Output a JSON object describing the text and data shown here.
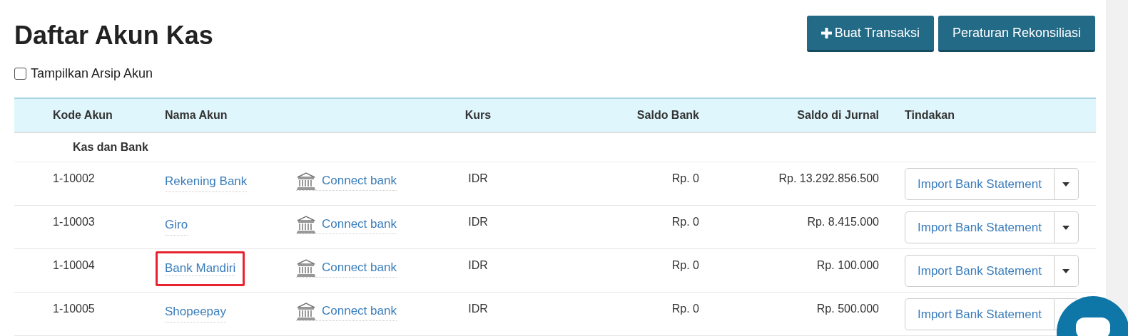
{
  "page": {
    "title": "Daftar Akun Kas"
  },
  "actions": [
    {
      "kind": "create",
      "label": "Buat Transaksi"
    },
    {
      "kind": "rules",
      "label": "Peraturan Rekonsiliasi"
    }
  ],
  "show_archive": {
    "label": "Tampilkan Arsip Akun",
    "checked": false
  },
  "table": {
    "columns": [
      {
        "label": "Kode Akun"
      },
      {
        "label": "Nama Akun"
      },
      {},
      {
        "label": "Kurs"
      },
      {
        "label": "Saldo Bank"
      },
      {
        "label": "Saldo di Jurnal"
      },
      {
        "label": "Tindakan"
      }
    ],
    "group": "Kas dan Bank",
    "rows": [
      {
        "code": "1-10002",
        "name": "Rekening Bank",
        "highlighted": false,
        "connect": "Connect bank",
        "currency": "IDR",
        "bank_balance": "Rp. 0",
        "journal_balance": "Rp. 13.292.856.500",
        "action": "Import Bank Statement"
      },
      {
        "code": "1-10003",
        "name": "Giro",
        "highlighted": false,
        "connect": "Connect bank",
        "currency": "IDR",
        "bank_balance": "Rp. 0",
        "journal_balance": "Rp. 8.415.000",
        "action": "Import Bank Statement"
      },
      {
        "code": "1-10004",
        "name": "Bank Mandiri",
        "highlighted": true,
        "connect": "Connect bank",
        "currency": "IDR",
        "bank_balance": "Rp. 0",
        "journal_balance": "Rp. 100.000",
        "action": "Import Bank Statement"
      },
      {
        "code": "1-10005",
        "name": "Shopeepay",
        "highlighted": false,
        "connect": "Connect bank",
        "currency": "IDR",
        "bank_balance": "Rp. 0",
        "journal_balance": "Rp. 500.000",
        "action": "Import Bank Statement"
      }
    ]
  }
}
